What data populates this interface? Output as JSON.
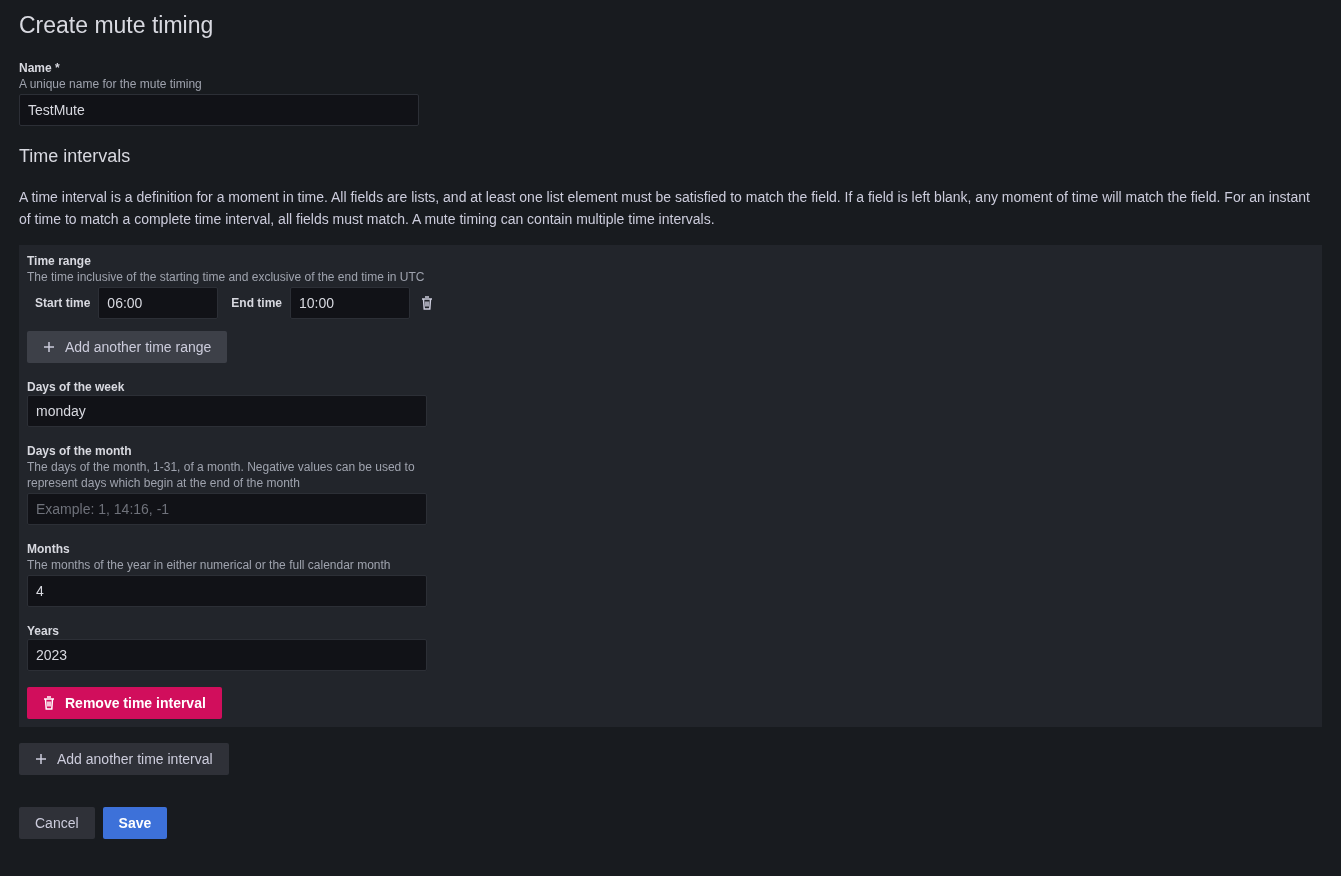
{
  "title": "Create mute timing",
  "name_field": {
    "label": "Name *",
    "description": "A unique name for the mute timing",
    "value": "TestMute"
  },
  "section_title": "Time intervals",
  "intro": "A time interval is a definition for a moment in time. All fields are lists, and at least one list element must be satisfied to match the field. If a field is left blank, any moment of time will match the field. For an instant of time to match a complete time interval, all fields must match. A mute timing can contain multiple time intervals.",
  "interval": {
    "time_range": {
      "label": "Time range",
      "description": "The time inclusive of the starting time and exclusive of the end time in UTC",
      "ranges": [
        {
          "start_label": "Start time",
          "start": "06:00",
          "end_label": "End time",
          "end": "10:00"
        }
      ],
      "add_button": "Add another time range"
    },
    "fields": [
      {
        "label": "Days of the week",
        "value": "monday"
      },
      {
        "label": "Days of the month",
        "description": "The days of the month, 1-31, of a month. Negative values can be used to represent days which begin at the end of the month",
        "placeholder": "Example: 1, 14:16, -1"
      },
      {
        "label": "Months",
        "description": "The months of the year in either numerical or the full calendar month",
        "value": "4"
      },
      {
        "label": "Years",
        "value": "2023"
      }
    ],
    "remove_button": "Remove time interval"
  },
  "add_interval_button": "Add another time interval",
  "actions": [
    {
      "label": "Cancel",
      "kind": "secondary"
    },
    {
      "label": "Save",
      "kind": "primary"
    }
  ]
}
